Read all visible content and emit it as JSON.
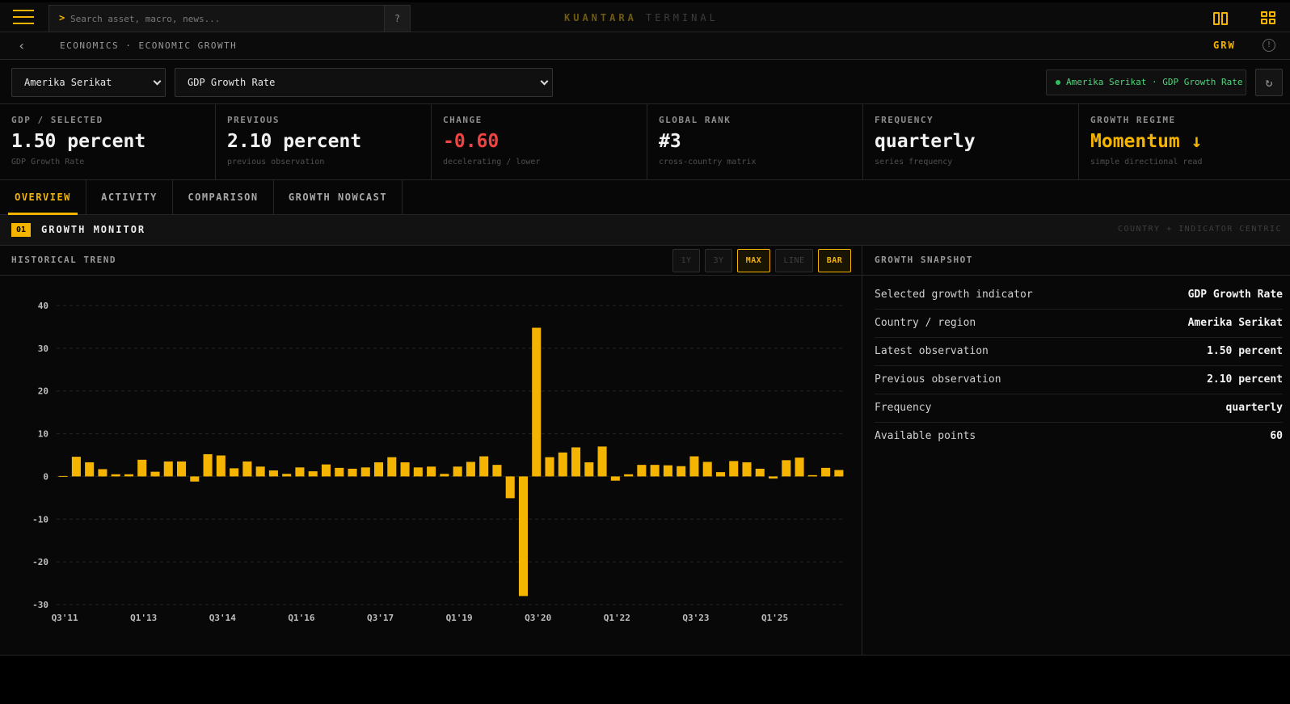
{
  "topbar": {
    "search_placeholder": "Search asset, macro, news...",
    "prompt": ">",
    "help": "?",
    "brand_primary": "KUANTARA",
    "brand_secondary": "TERMINAL"
  },
  "breadcrumb": {
    "back": "‹",
    "path": "ECONOMICS · ECONOMIC GROWTH",
    "code": "GRW",
    "info": "!"
  },
  "selectors": {
    "country": "Amerika Serikat",
    "indicator": "GDP Growth Rate",
    "status_pill": "Amerika Serikat · GDP Growth Rate",
    "refresh": "↻"
  },
  "stats": [
    {
      "label": "GDP / SELECTED",
      "value": "1.50 percent",
      "sub": "GDP Growth Rate"
    },
    {
      "label": "PREVIOUS",
      "value": "2.10 percent",
      "sub": "previous observation"
    },
    {
      "label": "CHANGE",
      "value": "-0.60",
      "sub": "decelerating / lower"
    },
    {
      "label": "GLOBAL RANK",
      "value": "#3",
      "sub": "cross-country matrix"
    },
    {
      "label": "FREQUENCY",
      "value": "quarterly",
      "sub": "series frequency"
    },
    {
      "label": "GROWTH REGIME",
      "value": "Momentum ↓",
      "sub": "simple directional read"
    }
  ],
  "tabs": [
    "OVERVIEW",
    "ACTIVITY",
    "COMPARISON",
    "GROWTH NOWCAST"
  ],
  "section": {
    "num": "01",
    "title": "GROWTH MONITOR",
    "right": "COUNTRY + INDICATOR CENTRIC"
  },
  "trend": {
    "title": "HISTORICAL TREND",
    "ranges": [
      "1Y",
      "3Y",
      "MAX",
      "LINE",
      "BAR"
    ]
  },
  "snapshot": {
    "title": "GROWTH SNAPSHOT",
    "rows": [
      {
        "k": "Selected growth indicator",
        "v": "GDP Growth Rate"
      },
      {
        "k": "Country / region",
        "v": "Amerika Serikat"
      },
      {
        "k": "Latest observation",
        "v": "1.50 percent"
      },
      {
        "k": "Previous observation",
        "v": "2.10 percent"
      },
      {
        "k": "Frequency",
        "v": "quarterly"
      },
      {
        "k": "Available points",
        "v": "60"
      }
    ]
  },
  "colors": {
    "accent": "#f5b400",
    "negative": "#ef4444",
    "positive": "#2fbf5f"
  },
  "chart_data": {
    "type": "bar",
    "yticks": [
      40,
      30,
      20,
      10,
      0,
      -10,
      -20,
      -30
    ],
    "ylim": [
      -30,
      40
    ],
    "xtick_labels": [
      "Q3'11",
      "Q1'13",
      "Q3'14",
      "Q1'16",
      "Q3'17",
      "Q1'19",
      "Q3'20",
      "Q1'22",
      "Q3'23",
      "Q1'25"
    ],
    "xtick_index": [
      0,
      6,
      12,
      18,
      24,
      30,
      36,
      42,
      48,
      54
    ],
    "series": [
      {
        "values": [
          0.1,
          4.6,
          3.3,
          1.7,
          0.5,
          0.5,
          3.9,
          1.1,
          3.5,
          3.5,
          -1.2,
          5.2,
          4.9,
          1.9,
          3.5,
          2.3,
          1.4,
          0.6,
          2.1,
          1.2,
          2.8,
          2.0,
          1.8,
          2.1,
          3.3,
          4.5,
          3.3,
          2.1,
          2.3,
          0.6,
          2.3,
          3.4,
          4.7,
          2.7,
          -5.1,
          -28.0,
          34.8,
          4.5,
          5.6,
          6.8,
          3.3,
          7.0,
          -1.0,
          0.5,
          2.7,
          2.7,
          2.6,
          2.4,
          4.7,
          3.4,
          1.0,
          3.6,
          3.3,
          1.8,
          -0.5,
          3.8,
          4.4,
          0.3,
          2.0,
          1.5
        ]
      }
    ]
  }
}
